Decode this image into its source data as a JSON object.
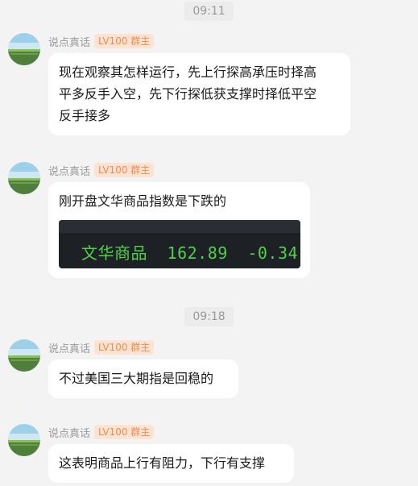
{
  "times": [
    "09:11",
    "09:18"
  ],
  "messages": [
    {
      "sender": "说点真话",
      "badge": "LV100 群主",
      "text_lines": [
        "现在观察其怎样运行，先上行探高承压时择高",
        "平多反手入空，先下行探低获支撑时择低平空",
        "反手接多"
      ]
    },
    {
      "sender": "说点真话",
      "badge": "LV100 群主",
      "text_lines": [
        "刚开盘文华商品指数是下跌的"
      ],
      "image": {
        "name": "文华商品",
        "price": "162.89",
        "change": "-0.34",
        "text_color": "#4fd14a",
        "bg_color": "#1d2024"
      }
    },
    {
      "sender": "说点真话",
      "badge": "LV100 群主",
      "text_lines": [
        "不过美国三大期指是回稳的"
      ]
    },
    {
      "sender": "说点真话",
      "badge": "LV100 群主",
      "text_lines": [
        "这表明商品上行有阻力，下行有支撑"
      ]
    }
  ],
  "colors": {
    "background": "#f3f3f3",
    "bubble": "#ffffff",
    "badge_bg": "#fde3d3",
    "badge_text": "#f08a4b",
    "muted_text": "#999999"
  },
  "icons": {
    "avatar": "landscape-avatar-icon"
  }
}
